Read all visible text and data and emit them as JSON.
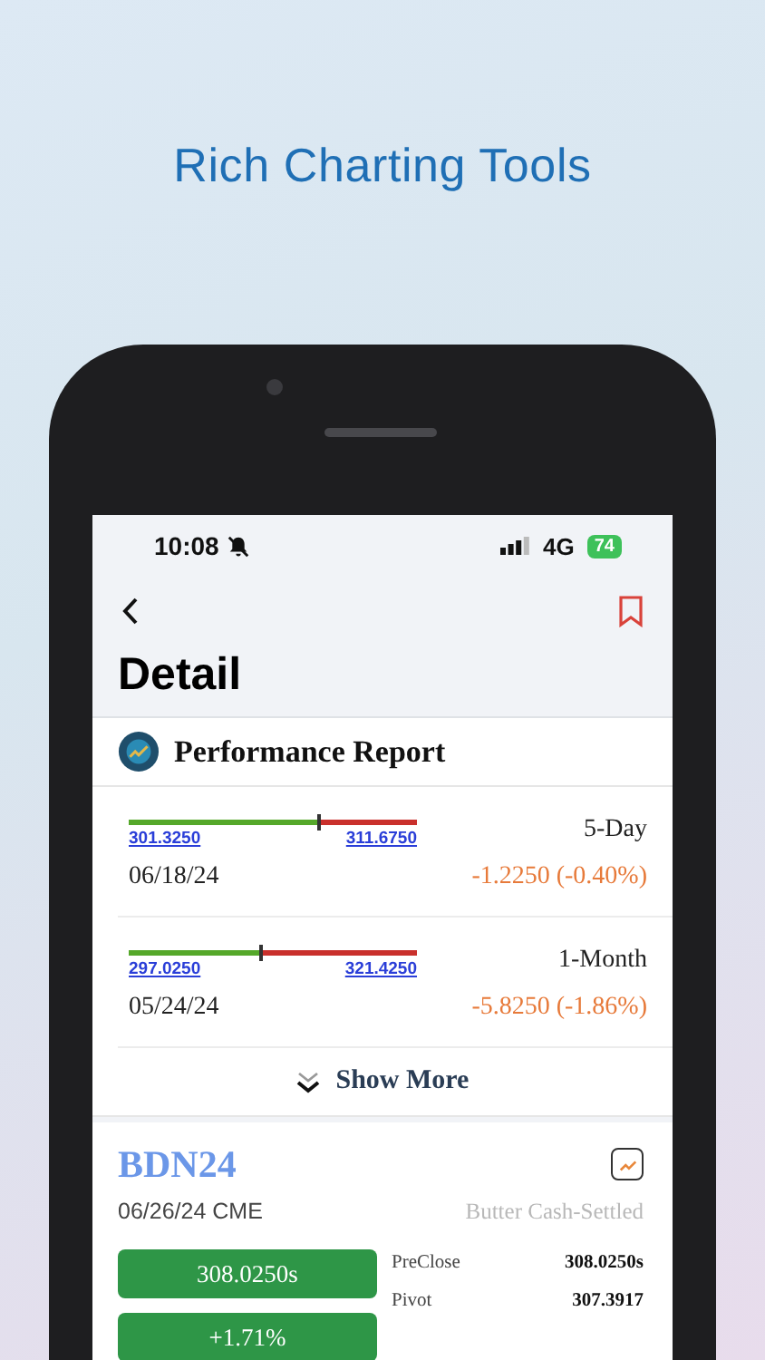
{
  "headline": "Rich Charting Tools",
  "status_bar": {
    "time": "10:08",
    "network": "4G",
    "battery": "74"
  },
  "page_title": "Detail",
  "performance_report": {
    "title": "Performance Report",
    "rows": [
      {
        "low": "301.3250",
        "high": "311.6750",
        "level": 0.66,
        "period": "5-Day",
        "date": "06/18/24",
        "change": "-1.2250 (-0.40%)"
      },
      {
        "low": "297.0250",
        "high": "321.4250",
        "level": 0.46,
        "period": "1-Month",
        "date": "05/24/24",
        "change": "-5.8250 (-1.86%)"
      }
    ],
    "show_more": "Show More"
  },
  "contract": {
    "symbol": "BDN24",
    "date_exchange": "06/26/24 CME",
    "name": "Butter Cash-Settled",
    "price_buttons": [
      "308.0250s",
      "+1.71%"
    ],
    "stats": [
      {
        "label": "PreClose",
        "value": "308.0250s"
      },
      {
        "label": "Pivot",
        "value": "307.3917"
      }
    ]
  }
}
